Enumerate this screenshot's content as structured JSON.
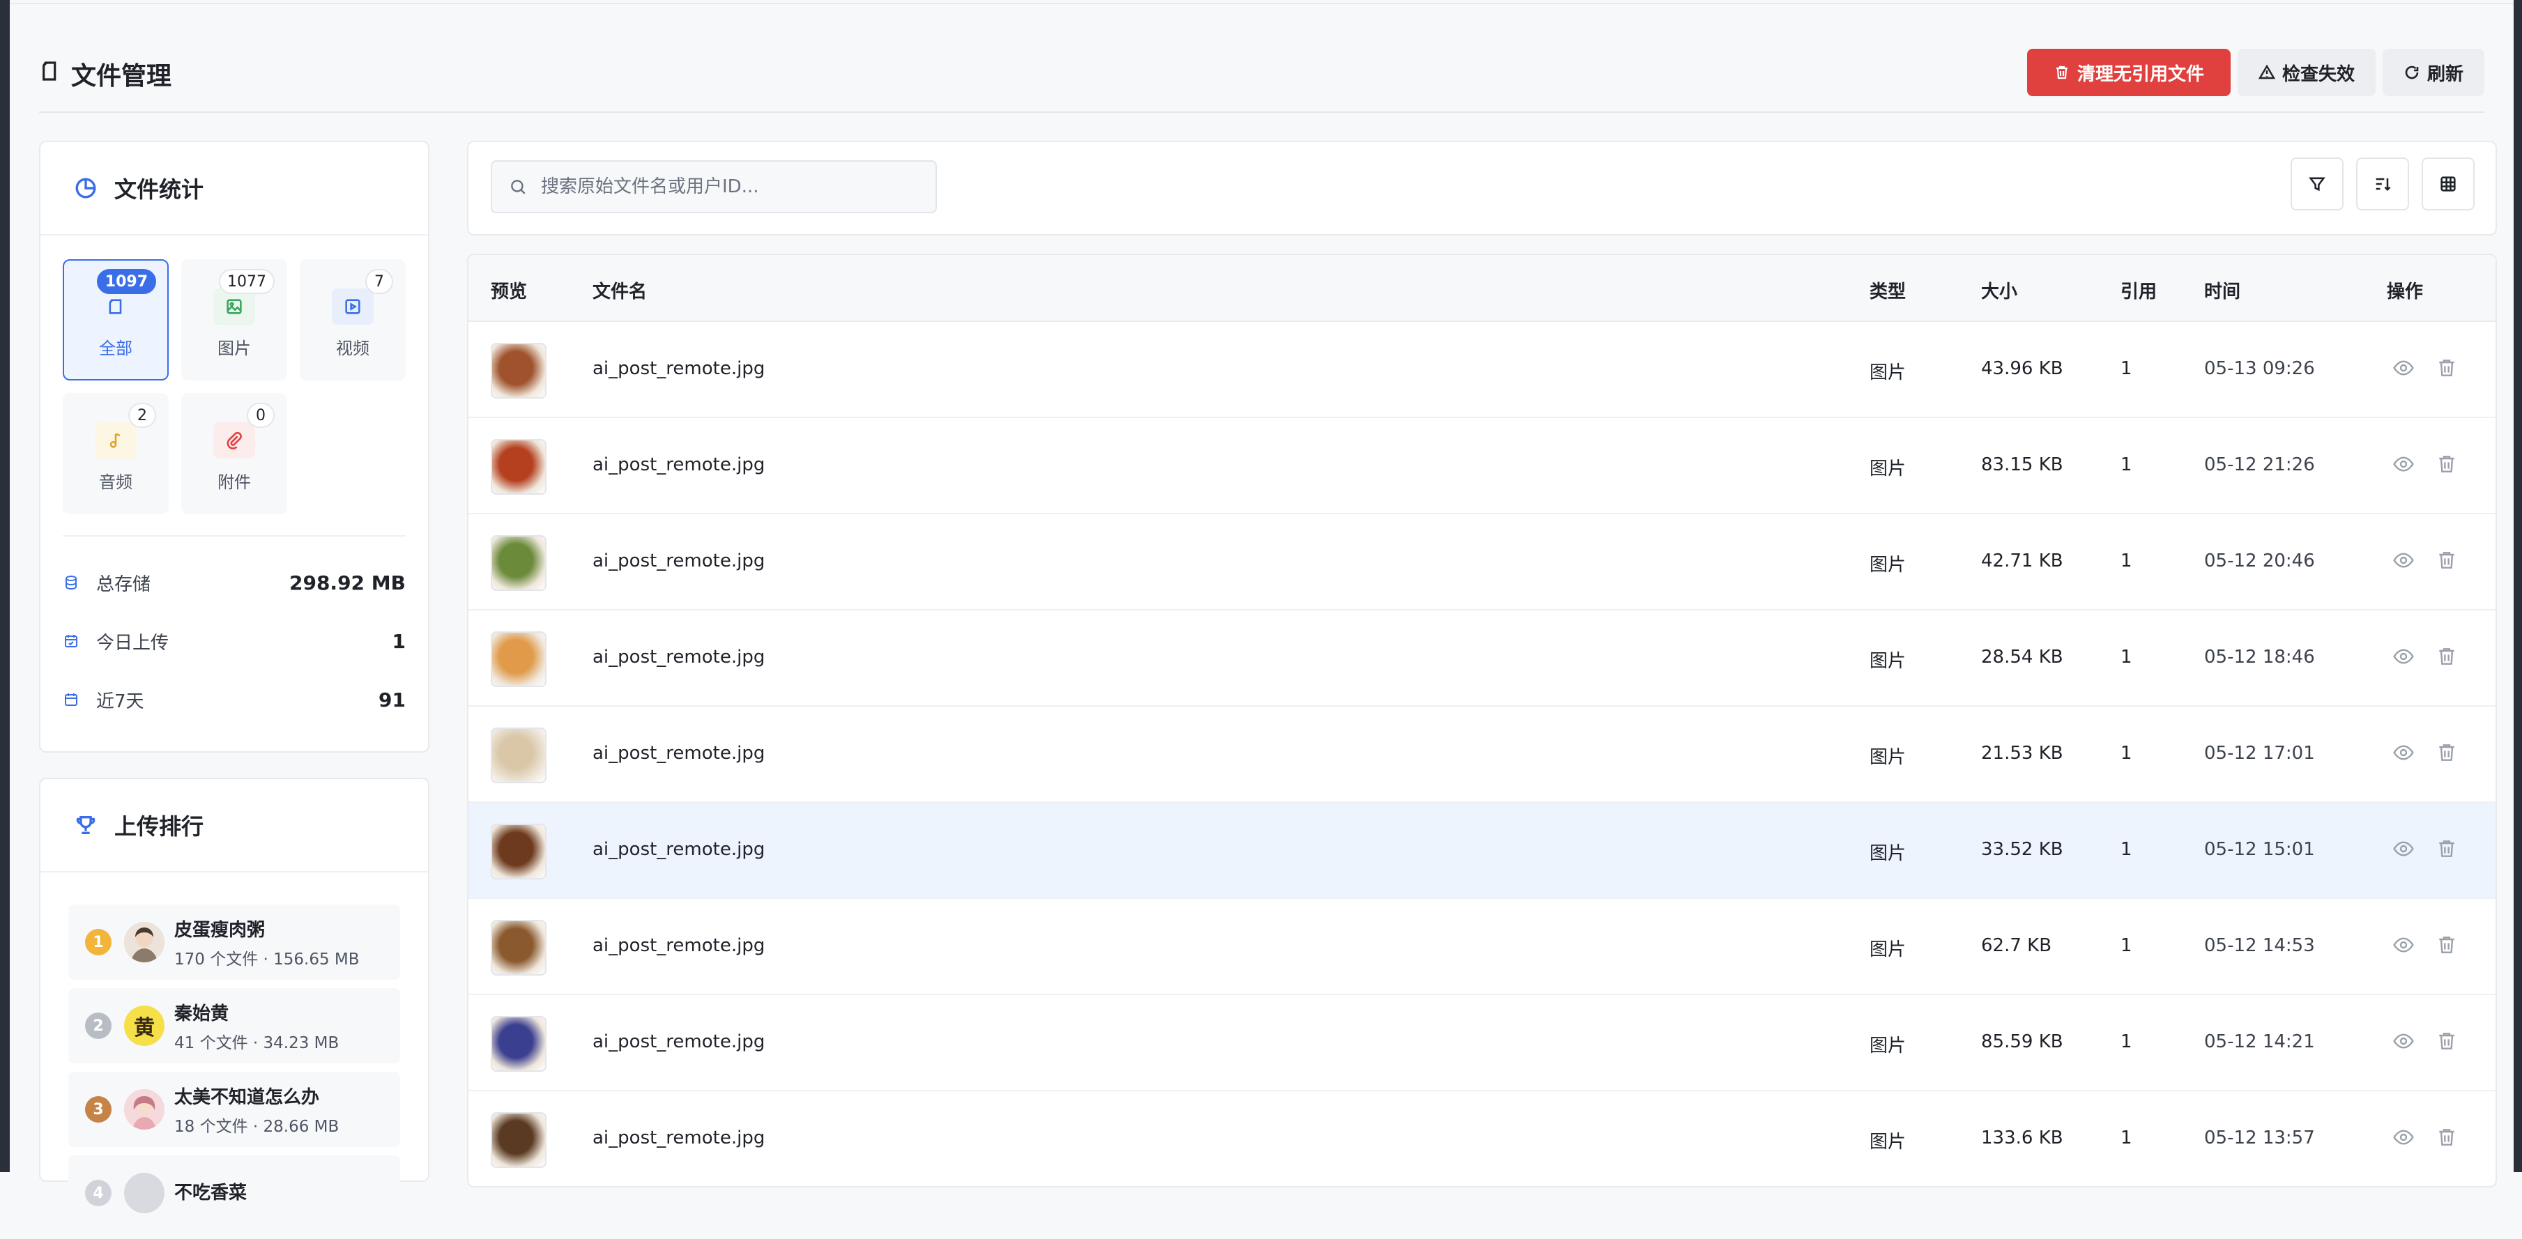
{
  "header": {
    "title": "文件管理",
    "btn_clean": "清理无引用文件",
    "btn_check": "检查失效",
    "btn_refresh": "刷新"
  },
  "stats": {
    "title": "文件统计",
    "types": [
      {
        "label": "全部",
        "count": "1097",
        "icon": "file-icon"
      },
      {
        "label": "图片",
        "count": "1077",
        "icon": "image-icon"
      },
      {
        "label": "视频",
        "count": "7",
        "icon": "video-icon"
      },
      {
        "label": "音频",
        "count": "2",
        "icon": "music-icon"
      },
      {
        "label": "附件",
        "count": "0",
        "icon": "paperclip-icon"
      }
    ],
    "rows": [
      {
        "label": "总存储",
        "value": "298.92 MB",
        "icon": "database-icon"
      },
      {
        "label": "今日上传",
        "value": "1",
        "icon": "calendar-check-icon"
      },
      {
        "label": "近7天",
        "value": "91",
        "icon": "calendar-icon"
      }
    ]
  },
  "ranking": {
    "title": "上传排行",
    "items": [
      {
        "rank": "1",
        "name": "皮蛋瘦肉粥",
        "meta": "170 个文件 · 156.65 MB",
        "avatar": "",
        "color": "#f2b43b"
      },
      {
        "rank": "2",
        "name": "秦始黄",
        "meta": "41 个文件 · 34.23 MB",
        "avatar": "黄",
        "color": "#b8bcc4"
      },
      {
        "rank": "3",
        "name": "太美不知道怎么办",
        "meta": "18 个文件 · 28.66 MB",
        "avatar": "",
        "color": "#c58346"
      },
      {
        "rank": "4",
        "name": "不吃香菜",
        "meta": "",
        "avatar": "",
        "color": "#d0d3d9"
      }
    ]
  },
  "search": {
    "placeholder": "搜索原始文件名或用户ID..."
  },
  "table": {
    "columns": {
      "preview": "预览",
      "name": "文件名",
      "type": "类型",
      "size": "大小",
      "refs": "引用",
      "time": "时间",
      "ops": "操作"
    },
    "rows": [
      {
        "name": "ai_post_remote.jpg",
        "type": "图片",
        "size": "43.96 KB",
        "refs": "1",
        "time": "05-13 09:26",
        "thumb": "#a0522d"
      },
      {
        "name": "ai_post_remote.jpg",
        "type": "图片",
        "size": "83.15 KB",
        "refs": "1",
        "time": "05-12 21:26",
        "thumb": "#b5401f"
      },
      {
        "name": "ai_post_remote.jpg",
        "type": "图片",
        "size": "42.71 KB",
        "refs": "1",
        "time": "05-12 20:46",
        "thumb": "#6b8a3a"
      },
      {
        "name": "ai_post_remote.jpg",
        "type": "图片",
        "size": "28.54 KB",
        "refs": "1",
        "time": "05-12 18:46",
        "thumb": "#e09a4a"
      },
      {
        "name": "ai_post_remote.jpg",
        "type": "图片",
        "size": "21.53 KB",
        "refs": "1",
        "time": "05-12 17:01",
        "thumb": "#d9c7a8"
      },
      {
        "name": "ai_post_remote.jpg",
        "type": "图片",
        "size": "33.52 KB",
        "refs": "1",
        "time": "05-12 15:01",
        "thumb": "#6e3a1e"
      },
      {
        "name": "ai_post_remote.jpg",
        "type": "图片",
        "size": "62.7 KB",
        "refs": "1",
        "time": "05-12 14:53",
        "thumb": "#8a5a2e"
      },
      {
        "name": "ai_post_remote.jpg",
        "type": "图片",
        "size": "85.59 KB",
        "refs": "1",
        "time": "05-12 14:21",
        "thumb": "#3b3f8f"
      },
      {
        "name": "ai_post_remote.jpg",
        "type": "图片",
        "size": "133.6 KB",
        "refs": "1",
        "time": "05-12 13:57",
        "thumb": "#5a3a22"
      }
    ]
  },
  "colors": {
    "accent": "#3a6ee8",
    "danger": "#e0403e"
  }
}
